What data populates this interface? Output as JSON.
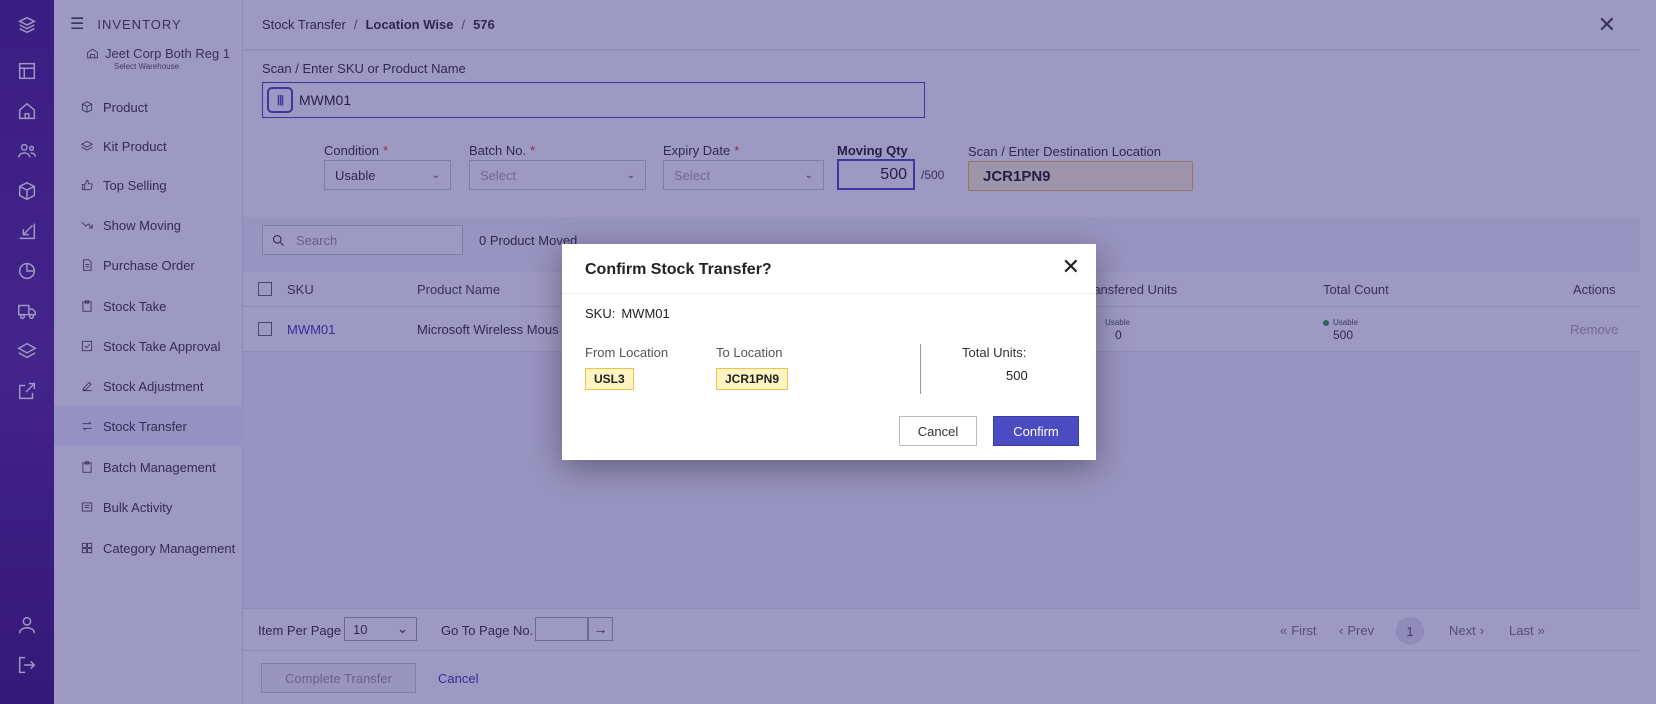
{
  "sidebar": {
    "title": "INVENTORY",
    "warehouse": {
      "name": "Jeet Corp Both Reg 1",
      "sub": "Select Warehouse"
    },
    "items": [
      {
        "label": "Product",
        "icon": "box-icon"
      },
      {
        "label": "Kit Product",
        "icon": "layers-icon"
      },
      {
        "label": "Top Selling",
        "icon": "thumbs-up-icon"
      },
      {
        "label": "Show Moving",
        "icon": "trend-down-icon"
      },
      {
        "label": "Purchase Order",
        "icon": "document-icon"
      },
      {
        "label": "Stock Take",
        "icon": "clipboard-icon"
      },
      {
        "label": "Stock Take Approval",
        "icon": "checkbox-icon"
      },
      {
        "label": "Stock Adjustment",
        "icon": "edit-icon"
      },
      {
        "label": "Stock Transfer",
        "icon": "transfer-icon"
      },
      {
        "label": "Batch Management",
        "icon": "clipboard-icon"
      },
      {
        "label": "Bulk Activity",
        "icon": "list-icon"
      },
      {
        "label": "Category Management",
        "icon": "grid-icon"
      }
    ]
  },
  "breadcrumb": {
    "part1": "Stock Transfer",
    "sep": "/",
    "part2": "Location Wise",
    "part3": "576"
  },
  "form": {
    "scan_label": "Scan / Enter SKU or Product Name",
    "scan_value": "MWM01",
    "condition_label": "Condition",
    "condition_value": "Usable",
    "batch_label": "Batch No.",
    "batch_placeholder": "Select",
    "expiry_label": "Expiry Date",
    "expiry_placeholder": "Select",
    "required_mark": "*",
    "qty_label": "Moving Qty",
    "qty_value": "500",
    "qty_max": "/500",
    "dest_label": "Scan / Enter Destination Location",
    "dest_value": "JCR1PN9"
  },
  "list": {
    "search_placeholder": "Search",
    "moved_count": "0 Product Moved",
    "columns": {
      "sku": "SKU",
      "product_name": "Product Name",
      "transferred": "ransfered Units",
      "total": "Total Count",
      "actions": "Actions"
    },
    "rows": [
      {
        "sku": "MWM01",
        "product_name": "Microsoft Wireless Mous",
        "transferred_tag": "Usable",
        "transferred_value": "0",
        "total_tag": "Usable",
        "total_value": "500",
        "action": "Remove"
      }
    ]
  },
  "pager": {
    "items_per_page_label": "Item Per Page",
    "items_per_page_value": "10",
    "goto_label": "Go To Page No.",
    "first": "First",
    "prev": "Prev",
    "current": "1",
    "next": "Next",
    "last": "Last"
  },
  "footer": {
    "complete_label": "Complete Transfer",
    "cancel_label": "Cancel"
  },
  "modal": {
    "title": "Confirm Stock Transfer?",
    "sku_label": "SKU:",
    "sku_value": "MWM01",
    "from_label": "From Location",
    "from_value": "USL3",
    "to_label": "To Location",
    "to_value": "JCR1PN9",
    "total_label": "Total Units:",
    "total_value": "500",
    "cancel_label": "Cancel",
    "confirm_label": "Confirm"
  },
  "colors": {
    "accent": "#4b4bc2",
    "rail": "#4b1f8a",
    "chip": "#fff4c2",
    "usable_dot": "#2e9e4c"
  }
}
